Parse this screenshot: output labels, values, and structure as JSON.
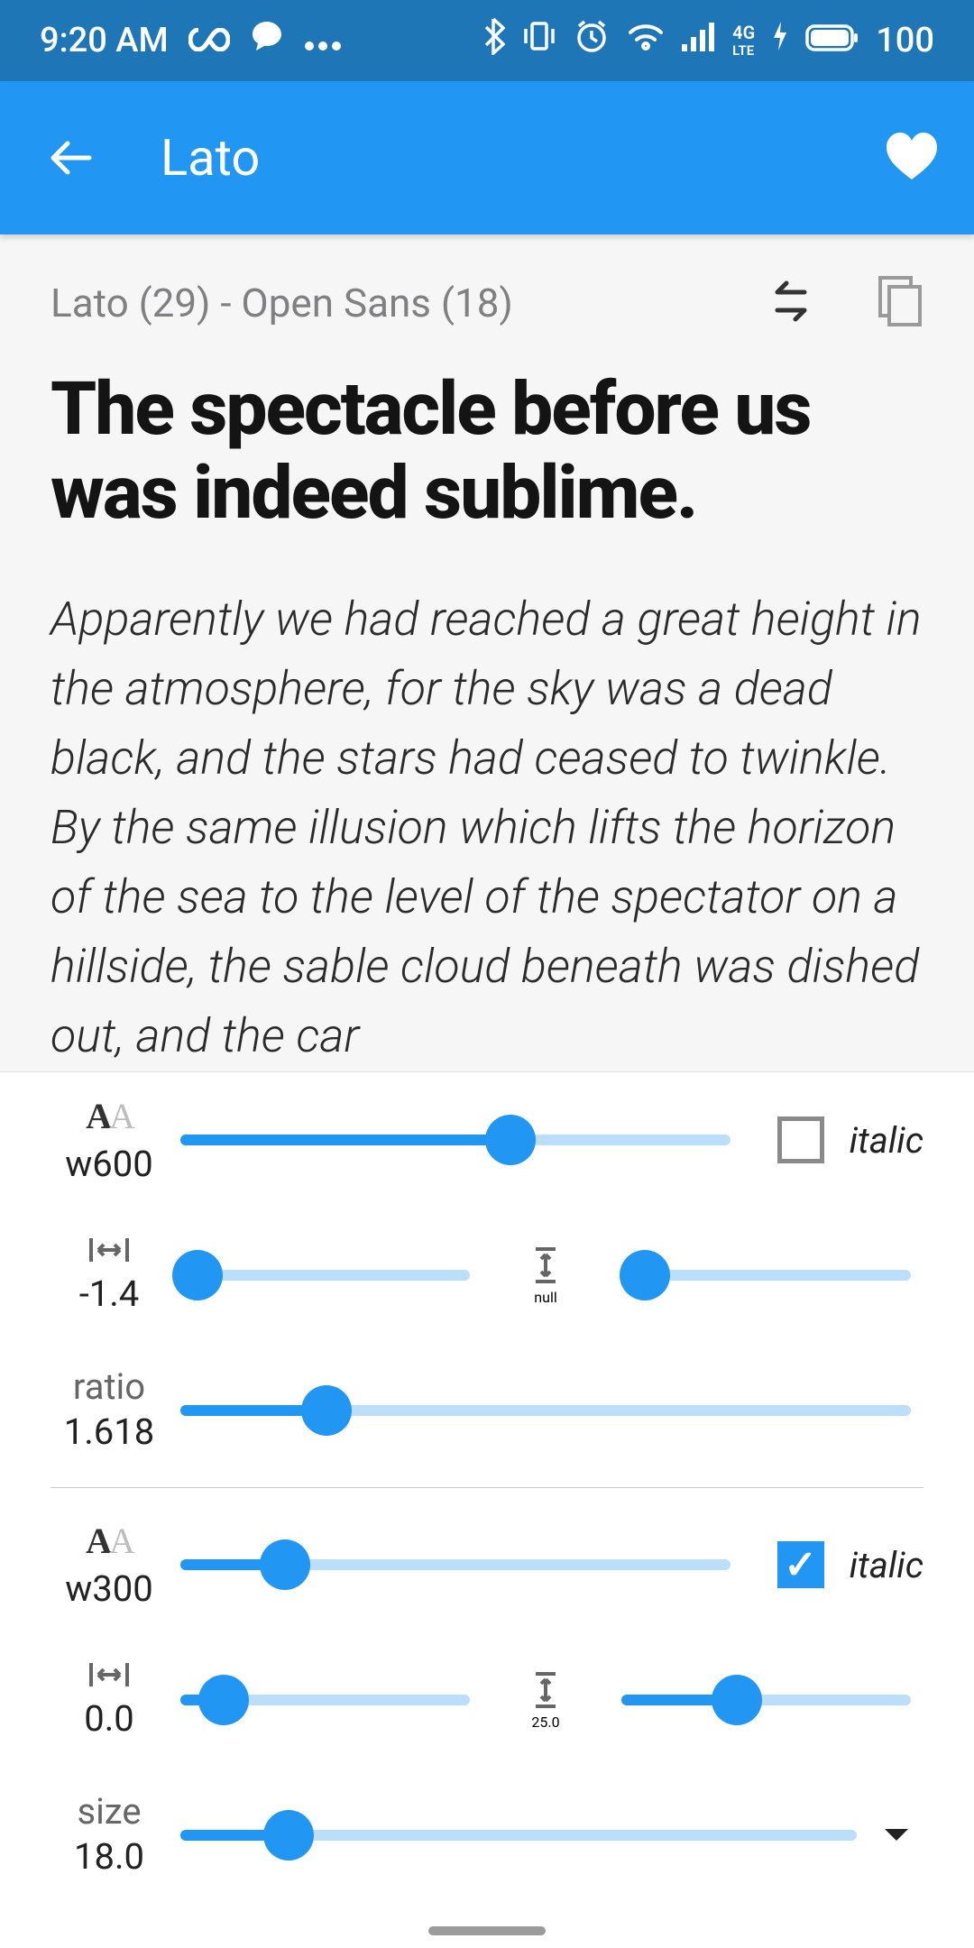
{
  "status": {
    "time": "9:20 AM",
    "battery": "100"
  },
  "appbar": {
    "title": "Lato"
  },
  "info": {
    "pair_text": "Lato (29) - Open Sans (18)"
  },
  "preview": {
    "headline": "The spectacle before us was indeed sublime.",
    "body": "Apparently we had reached a great height in the atmosphere, for the sky was a dead black, and the stars had ceased to twinkle. By the same illusion which lifts the horizon of the sea to the level of the spectator on a hillside, the sable cloud beneath was dished out, and the car"
  },
  "controls": {
    "headline": {
      "weight_value": "w600",
      "weight_pct": 60,
      "italic": false,
      "tracking_value": "-1.4",
      "tracking_pct": 6,
      "leading_value": "null",
      "leading_pct": 8,
      "ratio_label": "ratio",
      "ratio_value": "1.618",
      "ratio_pct": 20
    },
    "body": {
      "weight_value": "w300",
      "weight_pct": 19,
      "italic": true,
      "tracking_value": "0.0",
      "tracking_pct": 15,
      "leading_value": "25.0",
      "leading_pct": 40,
      "size_label": "size",
      "size_value": "18.0",
      "size_pct": 16
    },
    "italic_label": "italic"
  }
}
